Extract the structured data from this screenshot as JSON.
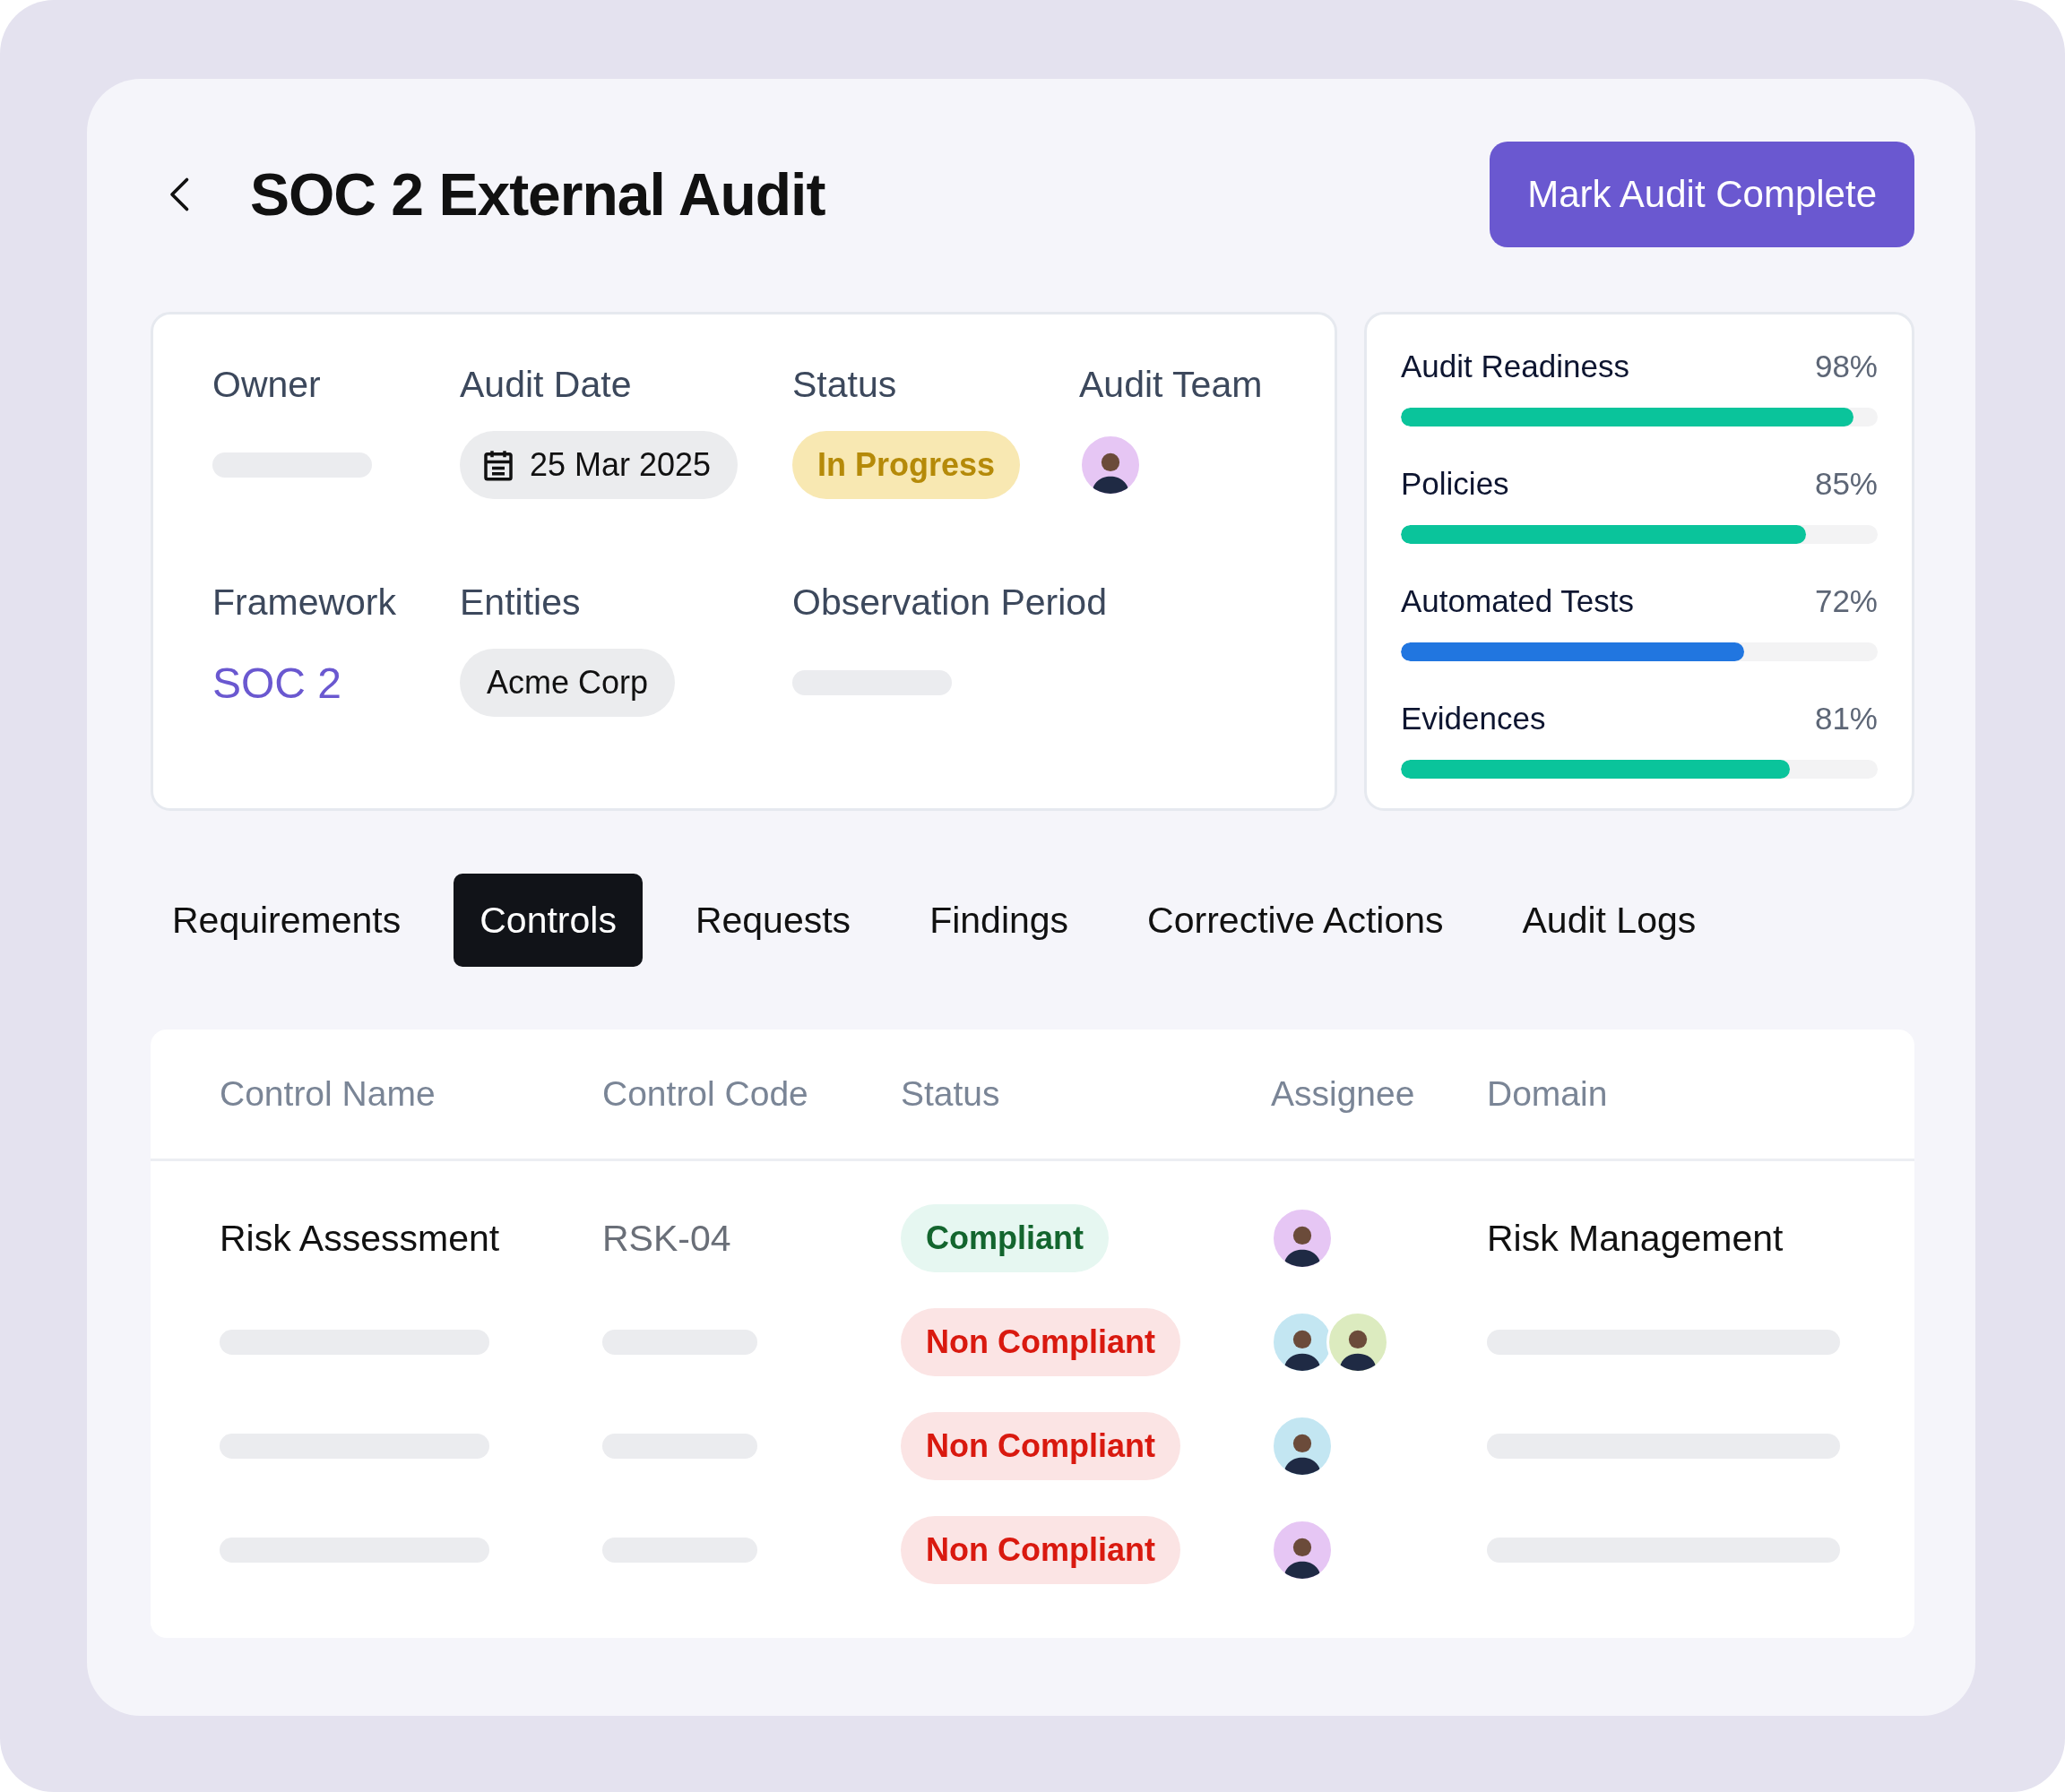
{
  "header": {
    "title": "SOC 2 External Audit",
    "action": "Mark Audit Complete"
  },
  "details": [
    {
      "label": "Owner",
      "kind": "skeleton"
    },
    {
      "label": "Audit Date",
      "kind": "date",
      "value": "25 Mar 2025"
    },
    {
      "label": "Status",
      "kind": "badge",
      "value": "In Progress"
    },
    {
      "label": "Audit Team",
      "kind": "avatars",
      "avatars": [
        {
          "color": "#e6c6f4"
        }
      ]
    },
    {
      "label": "Framework",
      "kind": "link",
      "value": "SOC 2"
    },
    {
      "label": "Entities",
      "kind": "chip",
      "value": "Acme Corp"
    },
    {
      "label": "Observation Period",
      "kind": "skeleton"
    }
  ],
  "progress": [
    {
      "label": "Audit Readiness",
      "reading": "98%",
      "level": 0.95,
      "color": "#0ac49b"
    },
    {
      "label": "Policies",
      "reading": "85%",
      "level": 0.85,
      "color": "#0ac49b"
    },
    {
      "label": "Automated Tests",
      "reading": "72%",
      "level": 0.72,
      "color": "#2176e0"
    },
    {
      "label": "Evidences",
      "reading": "81%",
      "level": 0.815,
      "color": "#0ac49b"
    }
  ],
  "tabs": [
    {
      "label": "Requirements",
      "selected": false
    },
    {
      "label": "Controls",
      "selected": true
    },
    {
      "label": "Requests",
      "selected": false
    },
    {
      "label": "Findings",
      "selected": false
    },
    {
      "label": "Corrective Actions",
      "selected": false
    },
    {
      "label": "Audit Logs",
      "selected": false
    }
  ],
  "table": {
    "columns": [
      "Control Name",
      "Control Code",
      "Status",
      "Assignee",
      "Domain"
    ],
    "rows": [
      {
        "control_name": "Risk Assessment",
        "control_code": "RSK-04",
        "status": {
          "label": "Compliant",
          "kind": "compliant"
        },
        "assignees": [
          {
            "color": "#e6c6f4"
          }
        ],
        "domain": "Risk Management"
      },
      {
        "status": {
          "label": "Non Compliant",
          "kind": "non_compliant"
        },
        "assignees": [
          {
            "color": "#c3e6f2"
          },
          {
            "color": "#dcebbf"
          }
        ]
      },
      {
        "status": {
          "label": "Non Compliant",
          "kind": "non_compliant"
        },
        "assignees": [
          {
            "color": "#c3e6f2"
          }
        ]
      },
      {
        "status": {
          "label": "Non Compliant",
          "kind": "non_compliant"
        },
        "assignees": [
          {
            "color": "#e6c6f4"
          }
        ]
      }
    ]
  }
}
